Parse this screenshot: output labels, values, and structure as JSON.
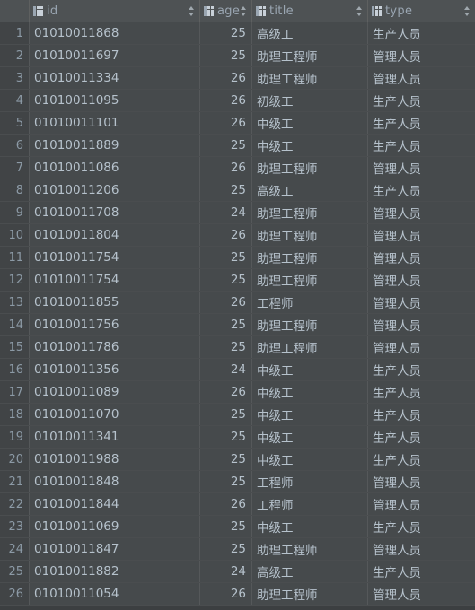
{
  "table": {
    "icons": {
      "column_icon": "table-grid-icon",
      "sort_icon": "sort-arrows-icon"
    },
    "columns": [
      {
        "key": "id",
        "label": "id"
      },
      {
        "key": "age",
        "label": "age"
      },
      {
        "key": "title",
        "label": "title"
      },
      {
        "key": "type",
        "label": "type"
      }
    ],
    "rows": [
      {
        "n": "1",
        "id": "01010011868",
        "age": "25",
        "title": "高级工",
        "type": "生产人员"
      },
      {
        "n": "2",
        "id": "01010011697",
        "age": "25",
        "title": "助理工程师",
        "type": "管理人员"
      },
      {
        "n": "3",
        "id": "01010011334",
        "age": "26",
        "title": "助理工程师",
        "type": "管理人员"
      },
      {
        "n": "4",
        "id": "01010011095",
        "age": "26",
        "title": "初级工",
        "type": "生产人员"
      },
      {
        "n": "5",
        "id": "01010011101",
        "age": "26",
        "title": "中级工",
        "type": "生产人员"
      },
      {
        "n": "6",
        "id": "01010011889",
        "age": "25",
        "title": "中级工",
        "type": "生产人员"
      },
      {
        "n": "7",
        "id": "01010011086",
        "age": "26",
        "title": "助理工程师",
        "type": "管理人员"
      },
      {
        "n": "8",
        "id": "01010011206",
        "age": "25",
        "title": "高级工",
        "type": "生产人员"
      },
      {
        "n": "9",
        "id": "01010011708",
        "age": "24",
        "title": "助理工程师",
        "type": "管理人员"
      },
      {
        "n": "10",
        "id": "01010011804",
        "age": "26",
        "title": "助理工程师",
        "type": "管理人员"
      },
      {
        "n": "11",
        "id": "01010011754",
        "age": "25",
        "title": "助理工程师",
        "type": "管理人员"
      },
      {
        "n": "12",
        "id": "01010011754",
        "age": "25",
        "title": "助理工程师",
        "type": "管理人员"
      },
      {
        "n": "13",
        "id": "01010011855",
        "age": "26",
        "title": "工程师",
        "type": "管理人员"
      },
      {
        "n": "14",
        "id": "01010011756",
        "age": "25",
        "title": "助理工程师",
        "type": "管理人员"
      },
      {
        "n": "15",
        "id": "01010011786",
        "age": "25",
        "title": "助理工程师",
        "type": "管理人员"
      },
      {
        "n": "16",
        "id": "01010011356",
        "age": "24",
        "title": "中级工",
        "type": "生产人员"
      },
      {
        "n": "17",
        "id": "01010011089",
        "age": "26",
        "title": "中级工",
        "type": "生产人员"
      },
      {
        "n": "18",
        "id": "01010011070",
        "age": "25",
        "title": "中级工",
        "type": "生产人员"
      },
      {
        "n": "19",
        "id": "01010011341",
        "age": "25",
        "title": "中级工",
        "type": "生产人员"
      },
      {
        "n": "20",
        "id": "01010011988",
        "age": "25",
        "title": "中级工",
        "type": "生产人员"
      },
      {
        "n": "21",
        "id": "01010011848",
        "age": "25",
        "title": "工程师",
        "type": "管理人员"
      },
      {
        "n": "22",
        "id": "01010011844",
        "age": "26",
        "title": "工程师",
        "type": "管理人员"
      },
      {
        "n": "23",
        "id": "01010011069",
        "age": "25",
        "title": "中级工",
        "type": "生产人员"
      },
      {
        "n": "24",
        "id": "01010011847",
        "age": "25",
        "title": "助理工程师",
        "type": "管理人员"
      },
      {
        "n": "25",
        "id": "01010011882",
        "age": "24",
        "title": "高级工",
        "type": "生产人员"
      },
      {
        "n": "26",
        "id": "01010011054",
        "age": "26",
        "title": "助理工程师",
        "type": "管理人员"
      }
    ]
  },
  "colors": {
    "header_bg": "#4e5254",
    "cell_bg": "#464a4c",
    "gutter_bg": "#414446",
    "text": "#b6c2cc",
    "grid_line": "#55585a"
  }
}
